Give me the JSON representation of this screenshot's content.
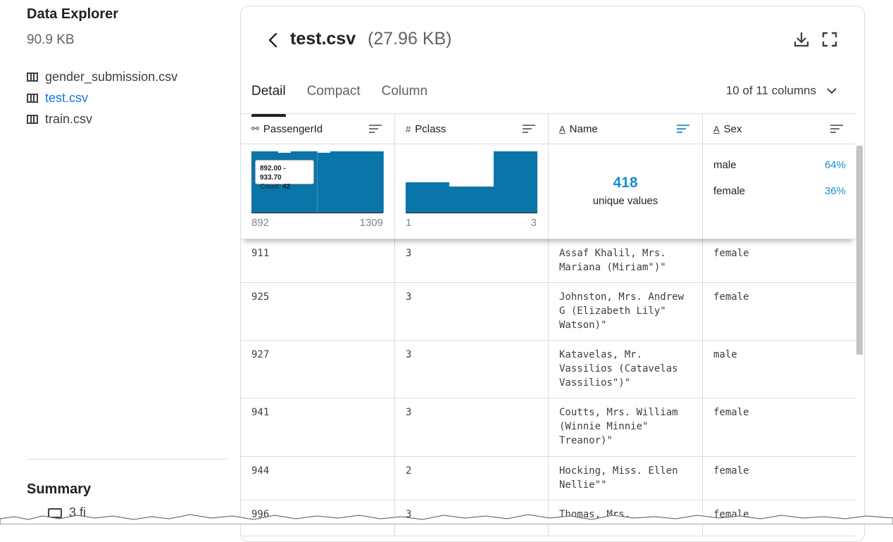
{
  "sidebar": {
    "title": "Data Explorer",
    "size": "90.9 KB",
    "files": [
      {
        "name": "gender_submission.csv",
        "active": false
      },
      {
        "name": "test.csv",
        "active": true
      },
      {
        "name": "train.csv",
        "active": false
      }
    ],
    "summary_title": "Summary",
    "summary_sub": "3 fi"
  },
  "header": {
    "file_name": "test.csv",
    "file_size": "(27.96 KB)",
    "download_icon": "download-icon",
    "fullscreen_icon": "fullscreen-icon"
  },
  "tabs": [
    {
      "label": "Detail",
      "active": true
    },
    {
      "label": "Compact",
      "active": false
    },
    {
      "label": "Column",
      "active": false
    }
  ],
  "column_selector": "10 of 11 columns",
  "columns": [
    {
      "name": "PassengerId",
      "type_icon": "⚯",
      "sort_active": false
    },
    {
      "name": "Pclass",
      "type_icon": "#",
      "sort_active": false
    },
    {
      "name": "Name",
      "type_icon": "A",
      "sort_active": true
    },
    {
      "name": "Sex",
      "type_icon": "A",
      "sort_active": false
    }
  ],
  "summary": {
    "passengerid": {
      "min": "892",
      "max": "1309",
      "tooltip_range": "892.00 - 933.70",
      "tooltip_count_label": "Count: ",
      "tooltip_count": "42",
      "bins": [
        42,
        42,
        41,
        42,
        42,
        41,
        42,
        42,
        42,
        42
      ]
    },
    "pclass": {
      "min": "1",
      "max": "3",
      "bins": [
        107,
        93,
        218
      ]
    },
    "name": {
      "unique_count": "418",
      "unique_label": "unique values"
    },
    "sex": {
      "categories": [
        {
          "label": "male",
          "pct": "64%"
        },
        {
          "label": "female",
          "pct": "36%"
        }
      ]
    }
  },
  "rows": [
    {
      "id": "911",
      "pclass": "3",
      "name": "Assaf Khalil, Mrs. Mariana (Miriam\")\"",
      "sex": "female"
    },
    {
      "id": "925",
      "pclass": "3",
      "name": "Johnston, Mrs. Andrew G (Elizabeth Lily\" Watson)\"",
      "sex": "female"
    },
    {
      "id": "927",
      "pclass": "3",
      "name": "Katavelas, Mr. Vassilios (Catavelas Vassilios\")\"",
      "sex": "male"
    },
    {
      "id": "941",
      "pclass": "3",
      "name": "Coutts, Mrs. William (Winnie Minnie\" Treanor)\"",
      "sex": "female"
    },
    {
      "id": "944",
      "pclass": "2",
      "name": "Hocking, Miss. Ellen Nellie\"\"",
      "sex": "female"
    },
    {
      "id": "996",
      "pclass": "3",
      "name": "Thomas, Mrs.",
      "sex": "female"
    }
  ],
  "colors": {
    "accent": "#1a8fd0",
    "bar": "#0a75a8",
    "link": "#1a73e8"
  }
}
